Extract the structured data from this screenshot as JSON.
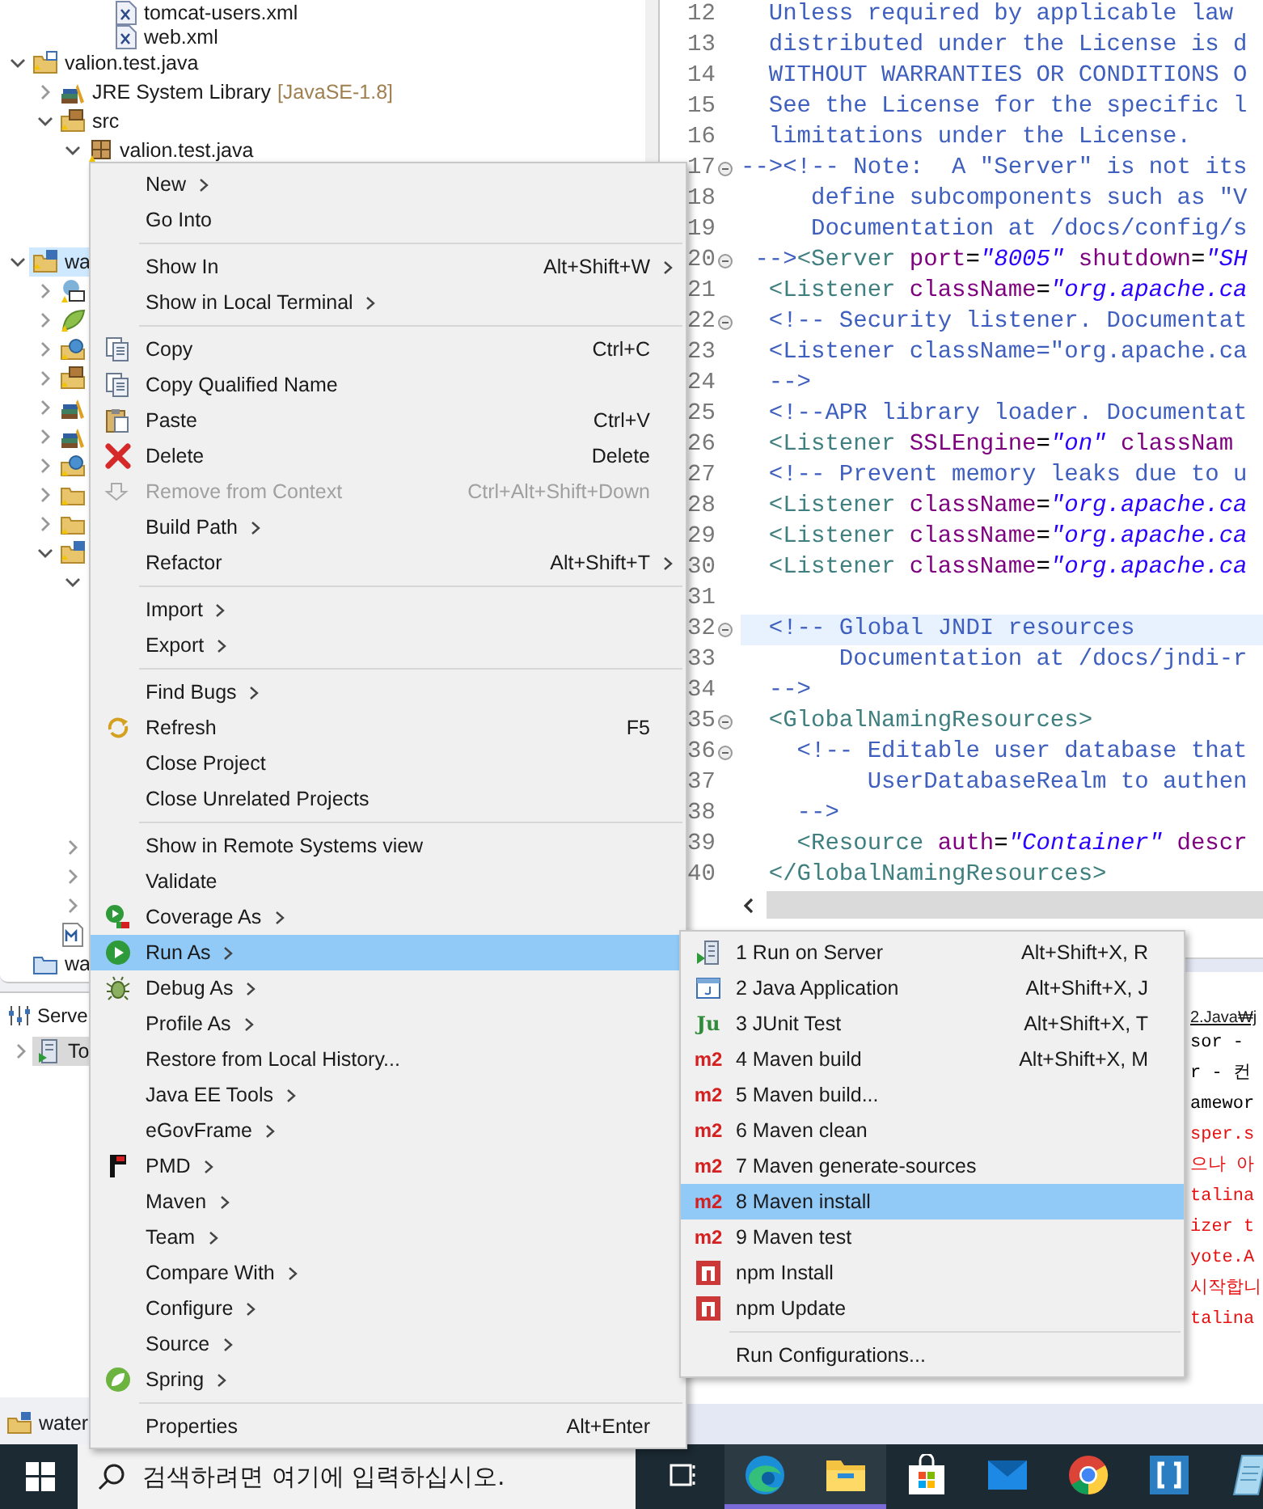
{
  "project_explorer": {
    "scrolled_rows": [
      {
        "label": "tomcat-users.xml"
      },
      {
        "label": "web.xml"
      }
    ],
    "tree": [
      {
        "label": "valion.test.java",
        "expanded": true,
        "selected": false,
        "children": [
          {
            "label": "JRE System Library",
            "decoration": "[JavaSE-1.8]",
            "expanded": false,
            "selected": false
          },
          {
            "label": "src",
            "expanded": true,
            "selected": false,
            "children": [
              {
                "label": "valion.test.java",
                "expanded": true,
                "selected": false
              }
            ]
          }
        ]
      },
      {
        "label": "wa",
        "expanded": true,
        "selected": true,
        "children": [
          {
            "expanded": false,
            "selected": false
          },
          {
            "expanded": false,
            "selected": false
          },
          {
            "expanded": false,
            "selected": false
          },
          {
            "expanded": false,
            "selected": false
          },
          {
            "expanded": false,
            "selected": false
          },
          {
            "expanded": false,
            "selected": false
          },
          {
            "expanded": false,
            "selected": false
          },
          {
            "expanded": false,
            "selected": false
          },
          {
            "expanded": false,
            "selected": false
          },
          {
            "expanded": true,
            "selected": false,
            "children": [
              {
                "expanded": true
              },
              {
                "expanded": false
              },
              {
                "expanded": false
              },
              {
                "expanded": false
              }
            ]
          },
          {
            "selected": false
          }
        ]
      },
      {
        "label": "wa",
        "selected": false
      }
    ]
  },
  "servers_view": {
    "tab": "Serve",
    "items": [
      {
        "label": "To",
        "expanded": false,
        "selected": true
      }
    ]
  },
  "status_item": {
    "label": "water"
  },
  "editor": {
    "lines": [
      {
        "number": "12",
        "foldable": false,
        "current": false,
        "segments": [
          {
            "kind": "comment",
            "text": "  Unless required by applicable law"
          }
        ]
      },
      {
        "number": "13",
        "foldable": false,
        "current": false,
        "segments": [
          {
            "kind": "comment",
            "text": "  distributed under the License is d"
          }
        ]
      },
      {
        "number": "14",
        "foldable": false,
        "current": false,
        "segments": [
          {
            "kind": "comment",
            "text": "  WITHOUT WARRANTIES OR CONDITIONS O"
          }
        ]
      },
      {
        "number": "15",
        "foldable": false,
        "current": false,
        "segments": [
          {
            "kind": "comment",
            "text": "  See the License for the specific l"
          }
        ]
      },
      {
        "number": "16",
        "foldable": false,
        "current": false,
        "segments": [
          {
            "kind": "comment",
            "text": "  limitations under the License."
          }
        ]
      },
      {
        "number": "17",
        "foldable": true,
        "current": false,
        "segments": [
          {
            "kind": "comment",
            "text": "--><!-- Note:  A \"Server\" is not its"
          }
        ]
      },
      {
        "number": "18",
        "foldable": false,
        "current": false,
        "segments": [
          {
            "kind": "comment",
            "text": "     define subcomponents such as \"V"
          }
        ]
      },
      {
        "number": "19",
        "foldable": false,
        "current": false,
        "segments": [
          {
            "kind": "comment",
            "text": "     Documentation at /docs/config/s"
          }
        ]
      },
      {
        "number": "20",
        "foldable": true,
        "current": false,
        "segments": [
          {
            "kind": "comment",
            "text": " -->"
          },
          {
            "kind": "tag",
            "text": "<Server"
          },
          {
            "kind": "attr",
            "text": " port"
          },
          {
            "kind": "plain",
            "text": "="
          },
          {
            "kind": "value",
            "text": "\"8005\""
          },
          {
            "kind": "attr",
            "text": " shutdown"
          },
          {
            "kind": "plain",
            "text": "="
          },
          {
            "kind": "value",
            "text": "\"SH"
          }
        ]
      },
      {
        "number": "21",
        "foldable": false,
        "current": false,
        "segments": [
          {
            "kind": "tag",
            "text": "  <Listener"
          },
          {
            "kind": "attr",
            "text": " className"
          },
          {
            "kind": "plain",
            "text": "="
          },
          {
            "kind": "value",
            "text": "\"org.apache.ca"
          }
        ]
      },
      {
        "number": "22",
        "foldable": true,
        "current": false,
        "segments": [
          {
            "kind": "comment",
            "text": "  <!-- Security listener. Documentat"
          }
        ]
      },
      {
        "number": "23",
        "foldable": false,
        "current": false,
        "segments": [
          {
            "kind": "comment",
            "text": "  <Listener className=\"org.apache.ca"
          }
        ]
      },
      {
        "number": "24",
        "foldable": false,
        "current": false,
        "segments": [
          {
            "kind": "comment",
            "text": "  -->"
          }
        ]
      },
      {
        "number": "25",
        "foldable": false,
        "current": false,
        "segments": [
          {
            "kind": "comment",
            "text": "  <!--APR library loader. Documentat"
          }
        ]
      },
      {
        "number": "26",
        "foldable": false,
        "current": false,
        "segments": [
          {
            "kind": "tag",
            "text": "  <Listener"
          },
          {
            "kind": "attr",
            "text": " SSLEngine"
          },
          {
            "kind": "plain",
            "text": "="
          },
          {
            "kind": "value",
            "text": "\"on\""
          },
          {
            "kind": "attr",
            "text": " classNam"
          }
        ]
      },
      {
        "number": "27",
        "foldable": false,
        "current": false,
        "segments": [
          {
            "kind": "comment",
            "text": "  <!-- Prevent memory leaks due to u"
          }
        ]
      },
      {
        "number": "28",
        "foldable": false,
        "current": false,
        "segments": [
          {
            "kind": "tag",
            "text": "  <Listener"
          },
          {
            "kind": "attr",
            "text": " className"
          },
          {
            "kind": "plain",
            "text": "="
          },
          {
            "kind": "value",
            "text": "\"org.apache.ca"
          }
        ]
      },
      {
        "number": "29",
        "foldable": false,
        "current": false,
        "segments": [
          {
            "kind": "tag",
            "text": "  <Listener"
          },
          {
            "kind": "attr",
            "text": " className"
          },
          {
            "kind": "plain",
            "text": "="
          },
          {
            "kind": "value",
            "text": "\"org.apache.ca"
          }
        ]
      },
      {
        "number": "30",
        "foldable": false,
        "current": false,
        "segments": [
          {
            "kind": "tag",
            "text": "  <Listener"
          },
          {
            "kind": "attr",
            "text": " className"
          },
          {
            "kind": "plain",
            "text": "="
          },
          {
            "kind": "value",
            "text": "\"org.apache.ca"
          }
        ]
      },
      {
        "number": "31",
        "foldable": false,
        "current": false
      },
      {
        "number": "32",
        "foldable": true,
        "current": true,
        "segments": [
          {
            "kind": "comment",
            "text": "  <!-- Global JNDI resources"
          }
        ]
      },
      {
        "number": "33",
        "foldable": false,
        "current": false,
        "segments": [
          {
            "kind": "comment",
            "text": "       Documentation at /docs/jndi-r"
          }
        ]
      },
      {
        "number": "34",
        "foldable": false,
        "current": false,
        "segments": [
          {
            "kind": "comment",
            "text": "  -->"
          }
        ]
      },
      {
        "number": "35",
        "foldable": true,
        "current": false,
        "segments": [
          {
            "kind": "tag",
            "text": "  <GlobalNamingResources>"
          }
        ]
      },
      {
        "number": "36",
        "foldable": true,
        "current": false,
        "segments": [
          {
            "kind": "comment",
            "text": "    <!-- Editable user database that"
          }
        ]
      },
      {
        "number": "37",
        "foldable": false,
        "current": false,
        "segments": [
          {
            "kind": "comment",
            "text": "         UserDatabaseRealm to authen"
          }
        ]
      },
      {
        "number": "38",
        "foldable": false,
        "current": false,
        "segments": [
          {
            "kind": "comment",
            "text": "    -->"
          }
        ]
      },
      {
        "number": "39",
        "foldable": false,
        "current": false,
        "segments": [
          {
            "kind": "tag",
            "text": "    <Resource"
          },
          {
            "kind": "attr",
            "text": " auth"
          },
          {
            "kind": "plain",
            "text": "="
          },
          {
            "kind": "value",
            "text": "\"Container\""
          },
          {
            "kind": "attr",
            "text": " descr"
          }
        ]
      },
      {
        "number": "40",
        "foldable": false,
        "current": false,
        "segments": [
          {
            "kind": "tag",
            "text": "  </GlobalNamingResources>"
          }
        ]
      }
    ]
  },
  "console": {
    "path": "2.Java₩j",
    "lines": [
      {
        "kind": "info",
        "text": "sor -"
      },
      {
        "kind": "info",
        "text": "r - 컨"
      },
      {
        "kind": "info",
        "text": "amewor"
      },
      {
        "kind": "error",
        "text": "sper.s"
      },
      {
        "kind": "error",
        "text": "으나 아"
      },
      {
        "kind": "error",
        "text": "talina"
      },
      {
        "kind": "error",
        "text": "izer t"
      },
      {
        "kind": "error",
        "text": "yote.A"
      },
      {
        "kind": "error",
        "text": "시작합니"
      },
      {
        "kind": "error",
        "text": "talina"
      }
    ]
  },
  "context_menu": {
    "groups": [
      [
        {
          "label": "New",
          "has_submenu": true,
          "disabled": false,
          "selected": false
        },
        {
          "label": "Go Into",
          "has_submenu": false,
          "disabled": false,
          "selected": false
        }
      ],
      [
        {
          "label": "Show In",
          "shortcut": "Alt+Shift+W",
          "has_submenu": true,
          "disabled": false,
          "selected": false
        },
        {
          "label": "Show in Local Terminal",
          "has_submenu": true,
          "disabled": false,
          "selected": false
        }
      ],
      [
        {
          "label": "Copy",
          "shortcut": "Ctrl+C",
          "has_submenu": false,
          "disabled": false,
          "selected": false
        },
        {
          "label": "Copy Qualified Name",
          "has_submenu": false,
          "disabled": false,
          "selected": false
        },
        {
          "label": "Paste",
          "shortcut": "Ctrl+V",
          "has_submenu": false,
          "disabled": false,
          "selected": false
        },
        {
          "label": "Delete",
          "shortcut": "Delete",
          "has_submenu": false,
          "disabled": false,
          "selected": false
        },
        {
          "label": "Remove from Context",
          "shortcut": "Ctrl+Alt+Shift+Down",
          "has_submenu": false,
          "disabled": true,
          "selected": false
        },
        {
          "label": "Build Path",
          "has_submenu": true,
          "disabled": false,
          "selected": false
        },
        {
          "label": "Refactor",
          "shortcut": "Alt+Shift+T",
          "has_submenu": true,
          "disabled": false,
          "selected": false
        }
      ],
      [
        {
          "label": "Import",
          "has_submenu": true,
          "disabled": false,
          "selected": false
        },
        {
          "label": "Export",
          "has_submenu": true,
          "disabled": false,
          "selected": false
        }
      ],
      [
        {
          "label": "Find Bugs",
          "has_submenu": true,
          "disabled": false,
          "selected": false
        },
        {
          "label": "Refresh",
          "shortcut": "F5",
          "has_submenu": false,
          "disabled": false,
          "selected": false
        },
        {
          "label": "Close Project",
          "has_submenu": false,
          "disabled": false,
          "selected": false
        },
        {
          "label": "Close Unrelated Projects",
          "has_submenu": false,
          "disabled": false,
          "selected": false
        }
      ],
      [
        {
          "label": "Show in Remote Systems view",
          "has_submenu": false,
          "disabled": false,
          "selected": false
        },
        {
          "label": "Validate",
          "has_submenu": false,
          "disabled": false,
          "selected": false
        },
        {
          "label": "Coverage As",
          "has_submenu": true,
          "disabled": false,
          "selected": false
        },
        {
          "label": "Run As",
          "has_submenu": true,
          "disabled": false,
          "selected": true
        },
        {
          "label": "Debug As",
          "has_submenu": true,
          "disabled": false,
          "selected": false
        },
        {
          "label": "Profile As",
          "has_submenu": true,
          "disabled": false,
          "selected": false
        },
        {
          "label": "Restore from Local History...",
          "has_submenu": false,
          "disabled": false,
          "selected": false
        },
        {
          "label": "Java EE Tools",
          "has_submenu": true,
          "disabled": false,
          "selected": false
        },
        {
          "label": "eGovFrame",
          "has_submenu": true,
          "disabled": false,
          "selected": false
        },
        {
          "label": "PMD",
          "has_submenu": true,
          "disabled": false,
          "selected": false
        },
        {
          "label": "Maven",
          "has_submenu": true,
          "disabled": false,
          "selected": false
        },
        {
          "label": "Team",
          "has_submenu": true,
          "disabled": false,
          "selected": false
        },
        {
          "label": "Compare With",
          "has_submenu": true,
          "disabled": false,
          "selected": false
        },
        {
          "label": "Configure",
          "has_submenu": true,
          "disabled": false,
          "selected": false
        },
        {
          "label": "Source",
          "has_submenu": true,
          "disabled": false,
          "selected": false
        },
        {
          "label": "Spring",
          "has_submenu": true,
          "disabled": false,
          "selected": false
        }
      ],
      [
        {
          "label": "Properties",
          "shortcut": "Alt+Enter",
          "has_submenu": false,
          "disabled": false,
          "selected": false
        }
      ]
    ]
  },
  "run_as_submenu": {
    "groups": [
      [
        {
          "label": "1 Run on Server",
          "shortcut": "Alt+Shift+X, R",
          "selected": false
        },
        {
          "label": "2 Java Application",
          "shortcut": "Alt+Shift+X, J",
          "selected": false
        },
        {
          "label": "3 JUnit Test",
          "shortcut": "Alt+Shift+X, T",
          "icon_text": "Ju",
          "selected": false
        },
        {
          "label": "4 Maven build",
          "shortcut": "Alt+Shift+X, M",
          "icon_text": "m2",
          "selected": false
        },
        {
          "label": "5 Maven build...",
          "icon_text": "m2",
          "selected": false
        },
        {
          "label": "6 Maven clean",
          "icon_text": "m2",
          "selected": false
        },
        {
          "label": "7 Maven generate-sources",
          "icon_text": "m2",
          "selected": false
        },
        {
          "label": "8 Maven install",
          "icon_text": "m2",
          "selected": true
        },
        {
          "label": "9 Maven test",
          "icon_text": "m2",
          "selected": false
        },
        {
          "label": "npm Install",
          "selected": false
        },
        {
          "label": "npm Update",
          "selected": false
        }
      ],
      [
        {
          "label": "Run Configurations...",
          "selected": false
        }
      ]
    ]
  },
  "taskbar": {
    "search": {
      "placeholder": "검색하려면 여기에 입력하십시오."
    },
    "apps": [
      {
        "running": false
      },
      {
        "running": true
      },
      {
        "running": true
      },
      {
        "running": false
      },
      {
        "running": false
      },
      {
        "running": false
      },
      {
        "running": false
      },
      {
        "running": false
      }
    ]
  }
}
